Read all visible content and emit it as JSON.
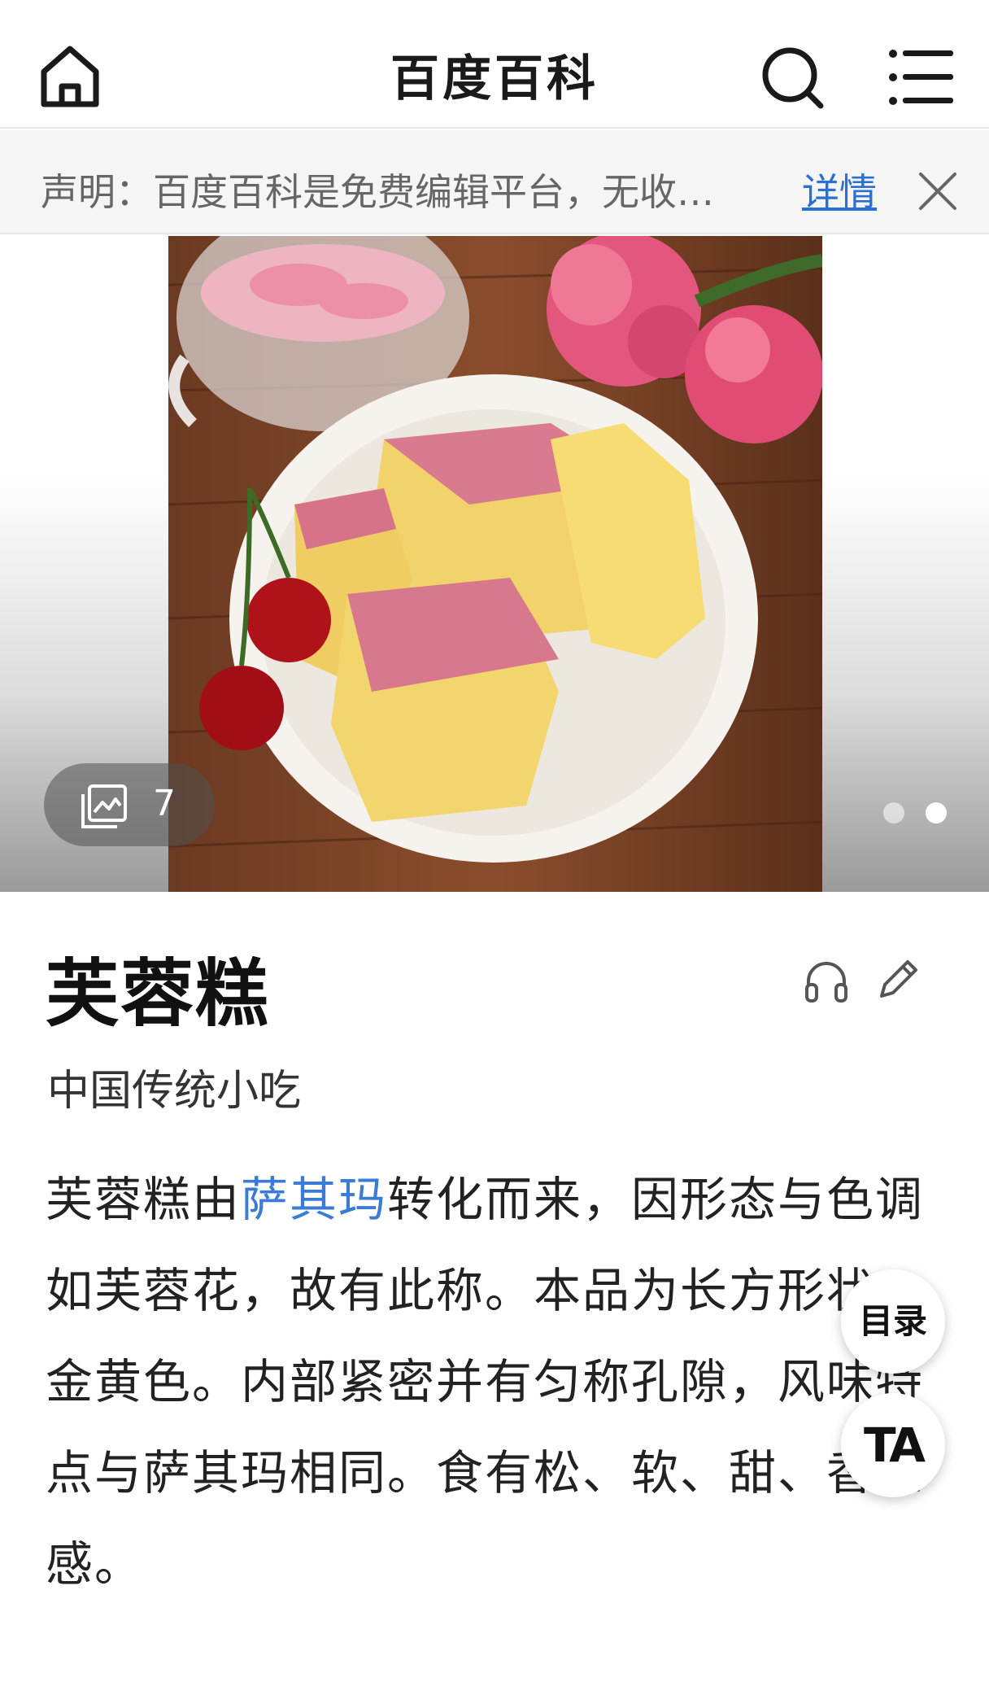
{
  "header": {
    "title": "百度百科",
    "icons": [
      "home-icon",
      "search-icon",
      "menu-icon"
    ]
  },
  "notice": {
    "text": "声明：百度百科是免费编辑平台，无收…",
    "link_label": "详情",
    "close_icon": "close-icon"
  },
  "gallery": {
    "image_count": "7",
    "image_count_icon": "image-gallery-icon",
    "pager_total": 2,
    "pager_active": 2
  },
  "entry": {
    "title": "芙蓉糕",
    "subtitle": "中国传统小吃",
    "summary_before_link": "芙蓉糕由",
    "summary_link": "萨其玛",
    "summary_after_link": "转化而来，因形态与色调如芙蓉花，故有此称。本品为长方形状，金黄色。内部紧密并有匀称孔隙，风味特点与萨其玛相同。食有松、软、甜、香之感。"
  },
  "actions": {
    "listen_icon": "headphone-icon",
    "edit_icon": "pencil-icon",
    "toc_label": "目录",
    "font_size_label": "TA"
  },
  "colors": {
    "link": "#3a7bd5",
    "notice_link": "#2a6fd6",
    "notice_bg": "#f5f5f5"
  }
}
